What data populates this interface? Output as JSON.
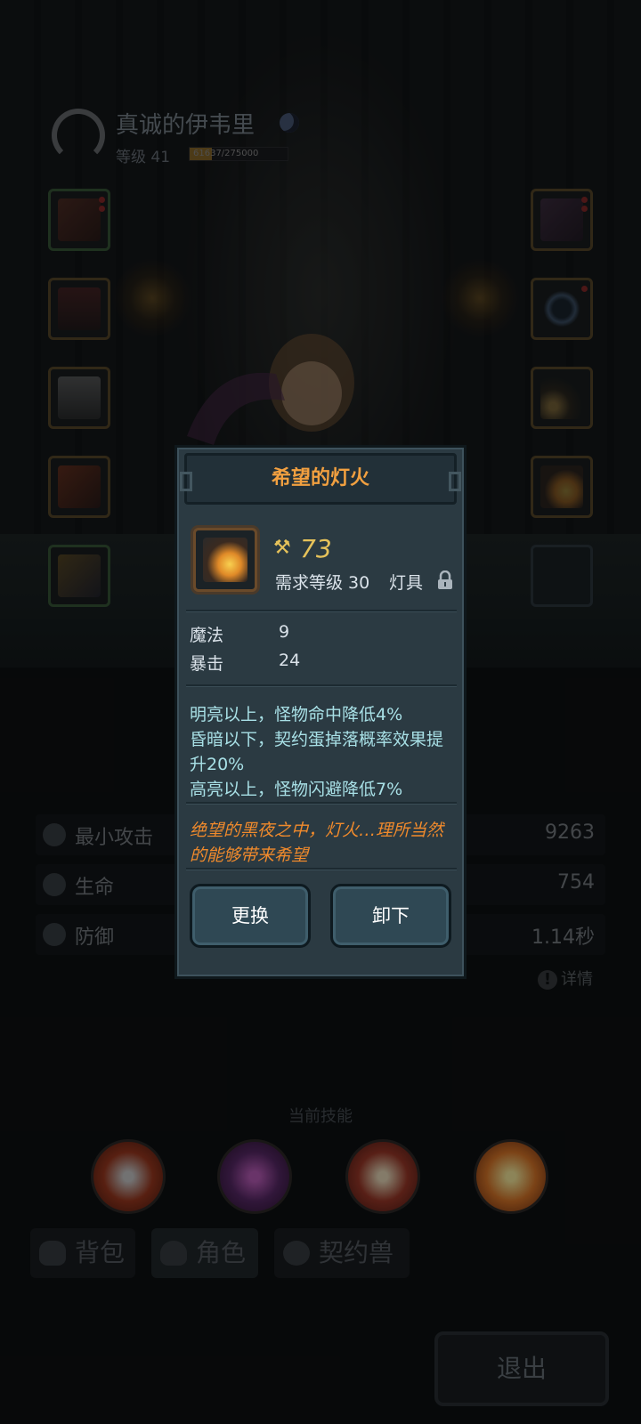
{
  "player": {
    "name": "真诚的伊韦里",
    "level_label": "等级 41",
    "exp_text": "61637/275000",
    "exp_fraction": 0.224
  },
  "stats": [
    {
      "label": "最小攻击",
      "value": "9263",
      "icon": "sword-icon"
    },
    {
      "label": "生命",
      "value": "754",
      "icon": "heart-icon"
    },
    {
      "label": "防御",
      "value": "1.14秒",
      "icon": "shield-icon"
    }
  ],
  "detail_label": "详情",
  "skills_title": "当前技能",
  "tabs": [
    {
      "label": "背包",
      "icon": "bag-icon"
    },
    {
      "label": "角色",
      "icon": "character-icon"
    },
    {
      "label": "契约兽",
      "icon": "paw-icon"
    }
  ],
  "exit_label": "退出",
  "modal": {
    "title": "希望的灯火",
    "power_value": "73",
    "required_level": "需求等级 30",
    "item_type": "灯具",
    "attributes": [
      {
        "name": "魔法",
        "value": "9"
      },
      {
        "name": "暴击",
        "value": "24"
      }
    ],
    "effects": [
      "明亮以上，怪物命中降低4%",
      "昏暗以下，契约蛋掉落概率效果提升20%",
      "高亮以上，怪物闪避降低7%"
    ],
    "lore": "绝望的黑夜之中，灯火…理所当然的能够带来希望",
    "replace_label": "更换",
    "unequip_label": "卸下"
  },
  "colors": {
    "title_orange": "#f2a040",
    "power_gold": "#e6c25a",
    "effect_cyan": "#a8e0e6",
    "lore_orange": "#f08a2c",
    "panel_bg": "#2b3a42"
  }
}
